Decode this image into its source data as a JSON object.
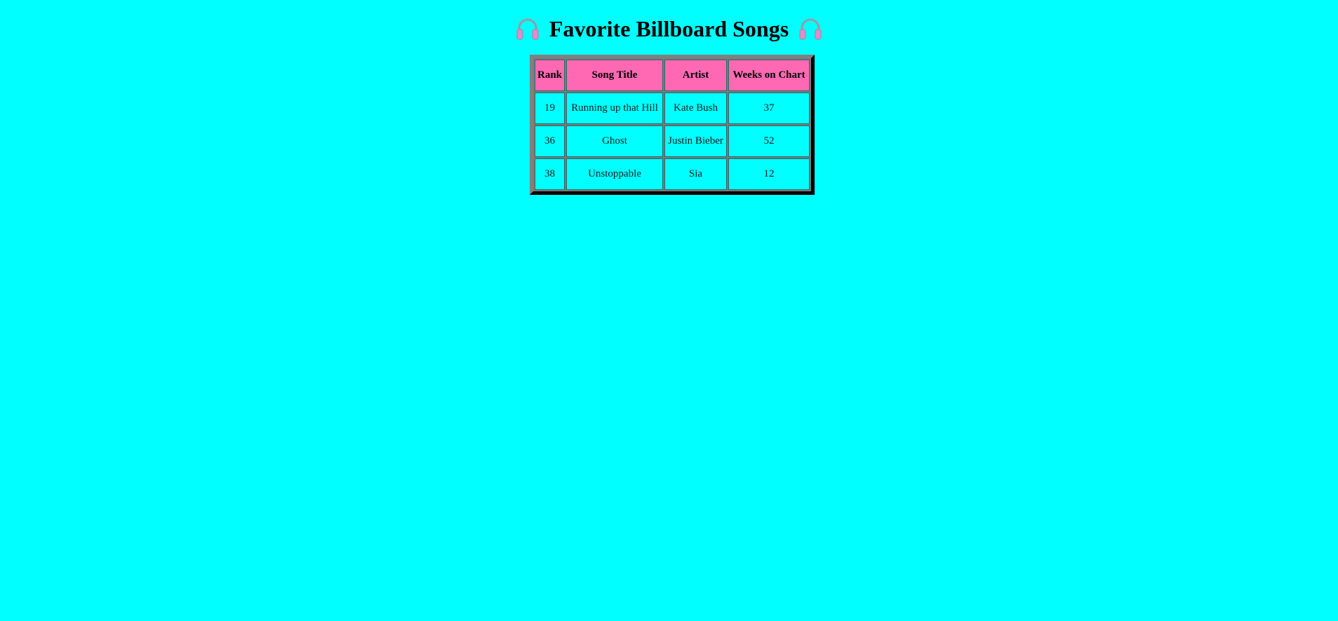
{
  "page": {
    "title": "Favorite Billboard Songs",
    "background_color": "#00ffff",
    "header_color": "#ff69b4",
    "title_icon": "headphones-icon"
  },
  "table": {
    "headers": [
      "Rank",
      "Song Title",
      "Artist",
      "Weeks on Chart"
    ],
    "rows": [
      {
        "rank": "19",
        "title": "Running up that Hill",
        "artist": "Kate Bush",
        "weeks": "37"
      },
      {
        "rank": "36",
        "title": "Ghost",
        "artist": "Justin Bieber",
        "weeks": "52"
      },
      {
        "rank": "38",
        "title": "Unstoppable",
        "artist": "Sia",
        "weeks": "12"
      }
    ]
  }
}
